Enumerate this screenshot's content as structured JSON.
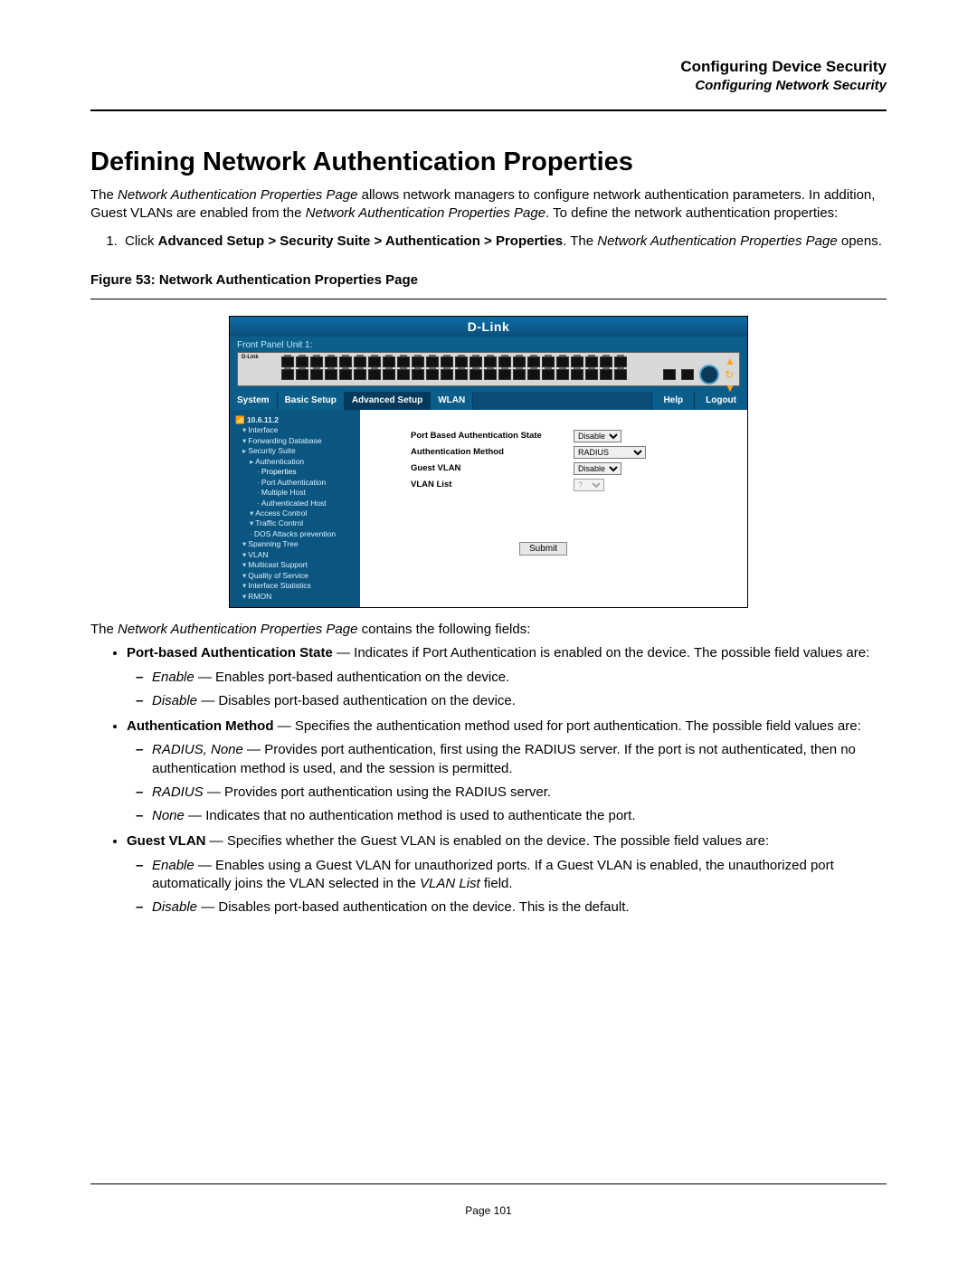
{
  "header": {
    "title": "Configuring Device Security",
    "subtitle": "Configuring Network Security"
  },
  "h1": "Defining Network Authentication Properties",
  "intro": {
    "t1": "The ",
    "t2": "Network Authentication Properties Page",
    "t3": " allows network managers to configure network authentication parameters. In addition, Guest VLANs are enabled from the ",
    "t4": "Network Authentication Properties Page",
    "t5": ". To define the network authentication properties:"
  },
  "step": {
    "s1a": "Click ",
    "s1b": "Advanced Setup > Security Suite > Authentication > Properties",
    "s1c": ". The ",
    "s1d": "Network Authentication Properties Page",
    "s1e": " opens."
  },
  "fig_caption": "Figure 53:  Network Authentication Properties Page",
  "shot": {
    "brand": "D-Link",
    "fp": "Front Panel Unit 1:",
    "dlabel": "D-Link",
    "tabs": {
      "system": "System",
      "basic": "Basic Setup",
      "adv": "Advanced Setup",
      "wlan": "WLAN",
      "help": "Help",
      "logout": "Logout"
    },
    "root_ip": "10.6.11.2",
    "tree": {
      "interface": "Interface",
      "fdb": "Forwarding Database",
      "sec": "Security Suite",
      "auth": "Authentication",
      "props": "Properties",
      "portauth": "Port Authentication",
      "multi": "Multiple Host",
      "ahost": "Authenticated Host",
      "acc": "Access Control",
      "traffic": "Traffic Control",
      "dos": "DOS Attacks prevention",
      "stp": "Spanning Tree",
      "vlan": "VLAN",
      "mcast": "Multicast Support",
      "qos": "Quality of Service",
      "ifstat": "Interface Statistics",
      "rmon": "RMON"
    },
    "form": {
      "l1": "Port Based Authentication State",
      "l2": "Authentication Method",
      "l3": "Guest VLAN",
      "l4": "VLAN List",
      "opt_disable": "Disable",
      "opt_radius": "RADIUS",
      "opt_q": "?",
      "submit": "Submit"
    }
  },
  "after_fig": {
    "a1": "The ",
    "a2": "Network Authentication Properties Page",
    "a3": " contains the following fields:"
  },
  "fields": {
    "f1": {
      "name": "Port-based Authentication State",
      "dash": " — ",
      "desc": "Indicates if Port Authentication is enabled on the device. The possible field values are:",
      "e_term": "Enable",
      "e_desc": " — Enables port-based authentication on the device.",
      "d_term": "Disable",
      "d_desc": " — Disables port-based authentication on the device."
    },
    "f2": {
      "name": "Authentication Method",
      "dash": " — ",
      "desc": "Specifies the authentication method used for port authentication. The possible field values are:",
      "rn_term": "RADIUS, None",
      "rn_desc": " — Provides port authentication, first using the RADIUS server. If the port is not authenticated, then no authentication method is used, and the session is permitted.",
      "r_term": "RADIUS",
      "r_desc": " — Provides port authentication using the RADIUS server.",
      "n_term": "None",
      "n_desc": " — Indicates that no authentication method is used to authenticate the port."
    },
    "f3": {
      "name": "Guest VLAN",
      "dash": " — ",
      "desc": "Specifies whether the Guest VLAN is enabled on the device. The possible field values are:",
      "e_term": "Enable",
      "e_desc1": " — Enables using a Guest VLAN for unauthorized ports. If a Guest VLAN is enabled, the unauthorized port automatically joins the VLAN selected in the ",
      "e_vl": "VLAN List",
      "e_desc2": " field.",
      "d_term": "Disable",
      "d_desc": " — Disables port-based authentication on the device. This is the default."
    }
  },
  "footer": {
    "page": "Page 101"
  }
}
